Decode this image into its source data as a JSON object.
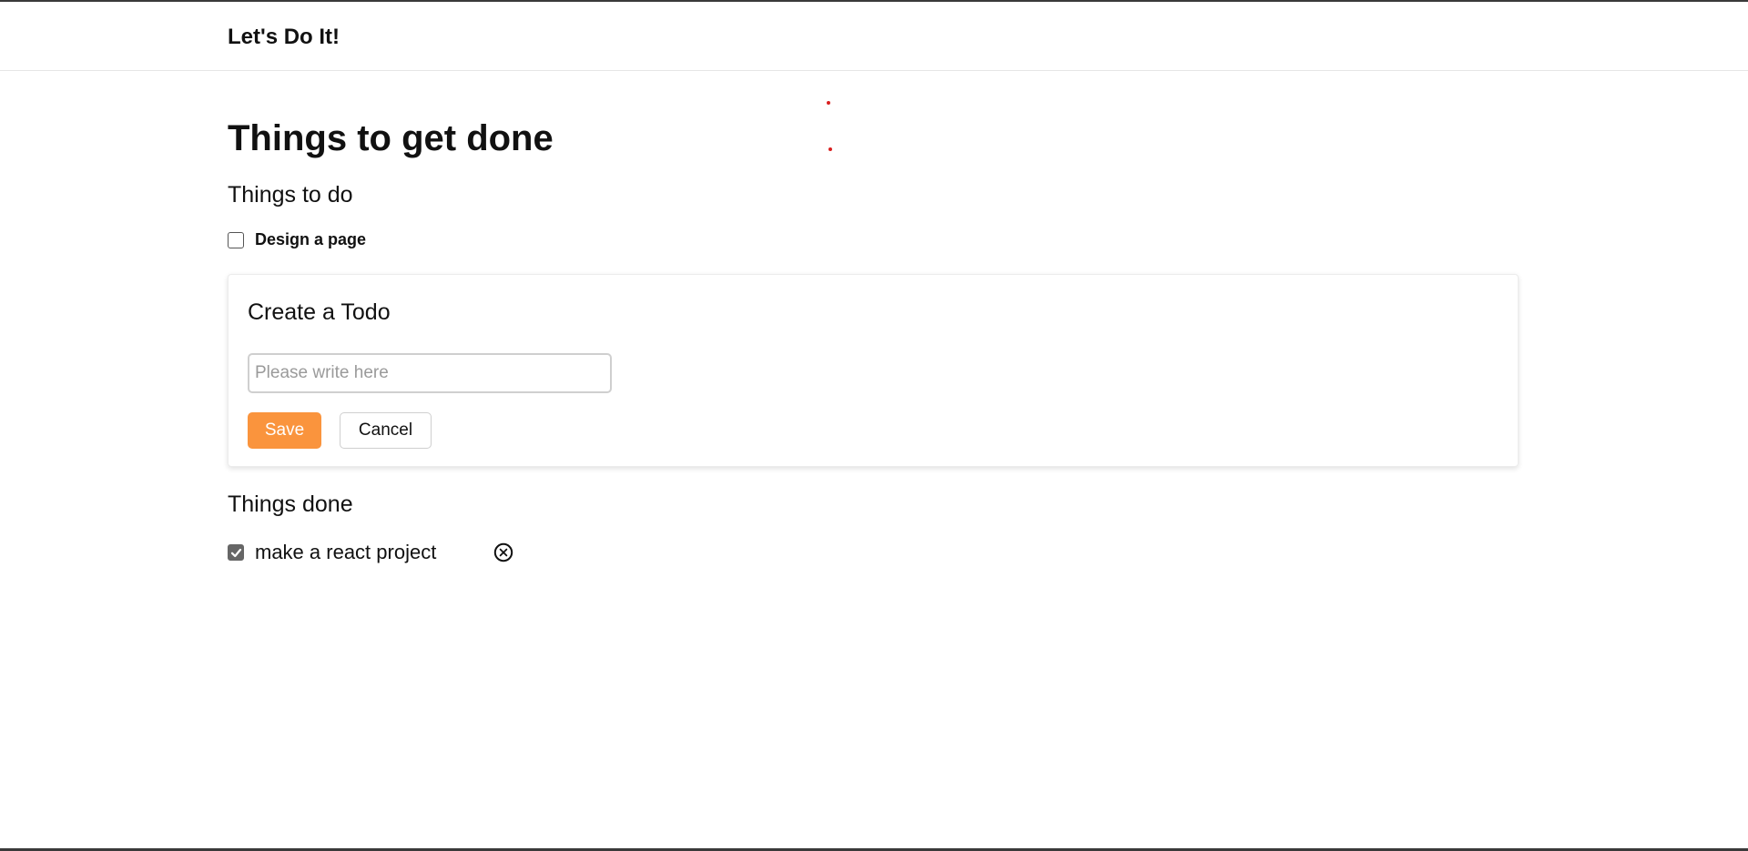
{
  "navbar": {
    "brand": "Let's Do It!"
  },
  "main": {
    "title": "Things to get done",
    "todo_section": {
      "heading": "Things to do",
      "items": [
        {
          "label": "Design a page",
          "checked": false
        }
      ]
    },
    "create_card": {
      "title": "Create a Todo",
      "input_value": "",
      "input_placeholder": "Please write here",
      "save_label": "Save",
      "cancel_label": "Cancel"
    },
    "done_section": {
      "heading": "Things done",
      "items": [
        {
          "label": "make a react project",
          "checked": true,
          "remove_icon": "circle-x-icon"
        }
      ]
    }
  },
  "colors": {
    "accent": "#fa943d",
    "text": "#111111",
    "checkbox_checked": "#666666",
    "marker_dot": "#d92020"
  }
}
